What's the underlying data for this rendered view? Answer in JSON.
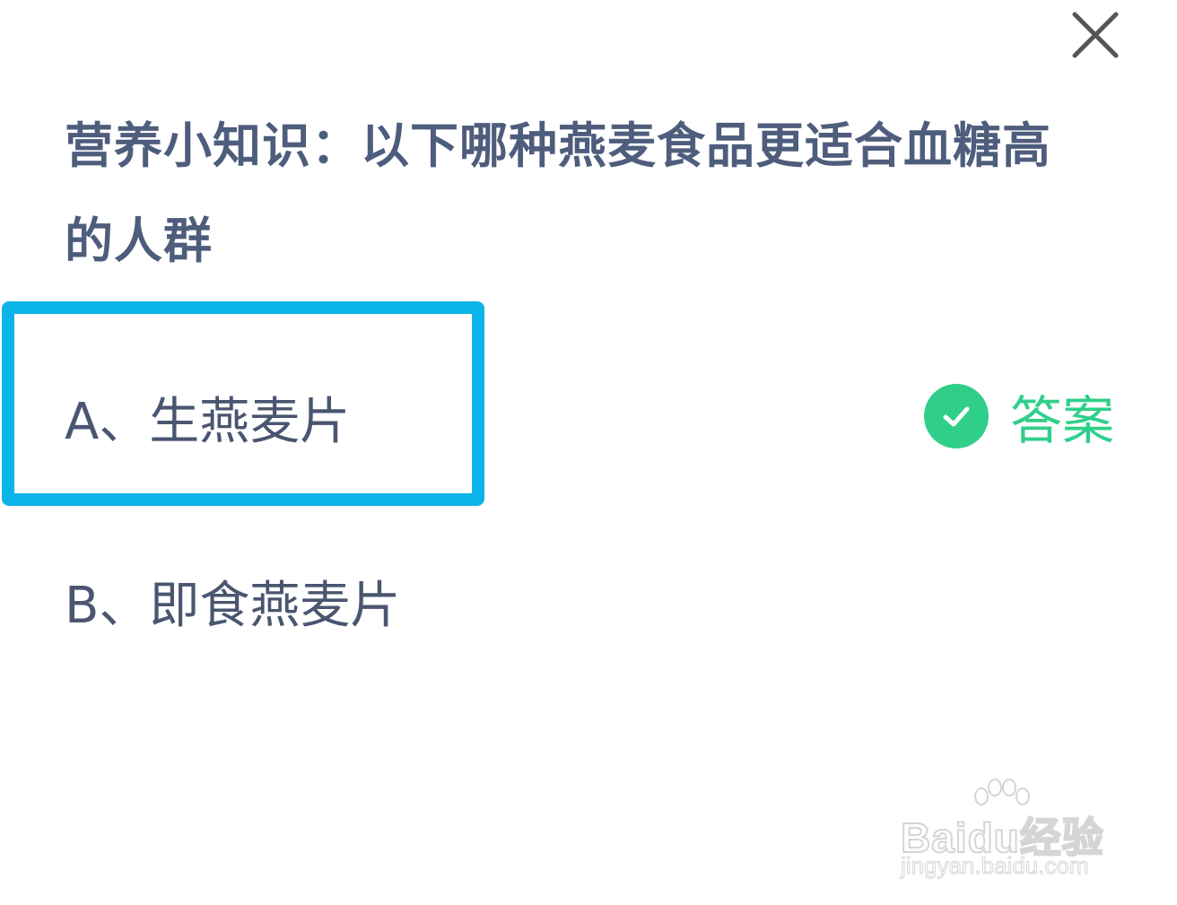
{
  "dialog": {
    "question": "营养小知识：以下哪种燕麦食品更适合血糖高的人群",
    "options": [
      {
        "label": "A、生燕麦片"
      },
      {
        "label": "B、即食燕麦片"
      }
    ],
    "answer_label": "答案",
    "close_icon": "close-icon",
    "check_icon": "check-circle-icon"
  },
  "watermark": {
    "brand": "Baidu经验",
    "url": "jingyan.baidu.com"
  },
  "colors": {
    "question_text": "#4e5d7c",
    "option_text": "#4a5670",
    "highlight_border": "#0ab4e8",
    "answer_green": "#2fcf8a"
  }
}
